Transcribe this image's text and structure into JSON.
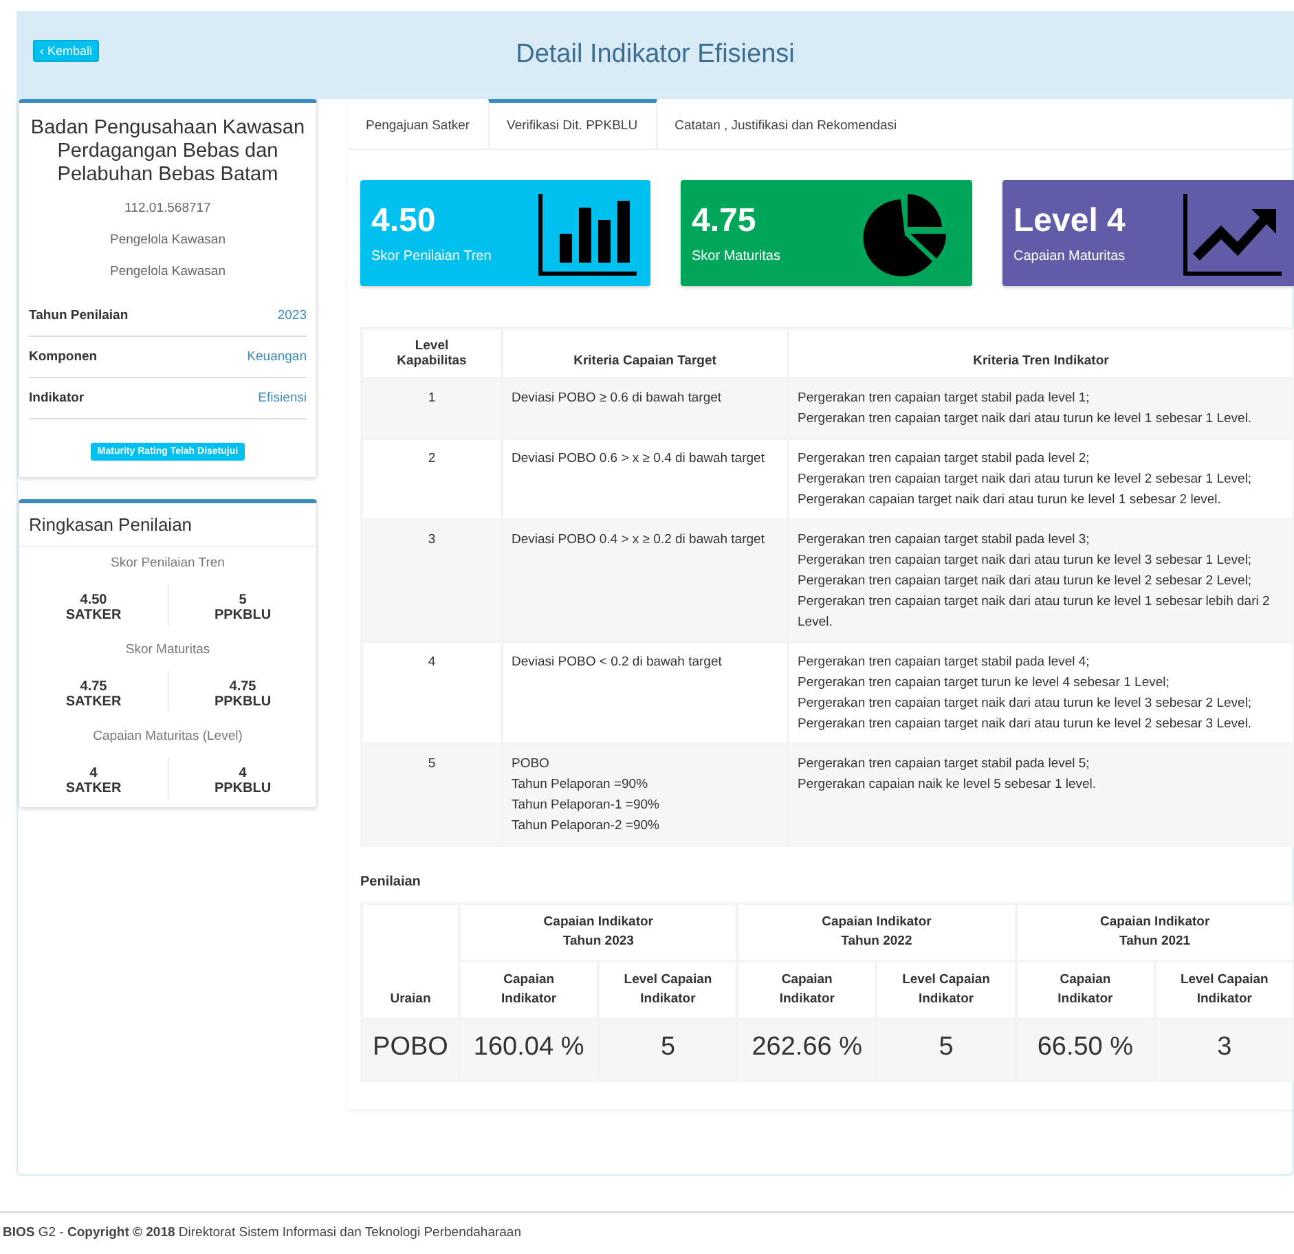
{
  "header": {
    "back_button": "‹ Kembali",
    "title": "Detail Indikator Efisiensi"
  },
  "profile": {
    "name": "Badan Pengusahaan Kawasan Perdagangan Bebas dan Pelabuhan Bebas Batam",
    "code": "112.01.568717",
    "lines": [
      "Pengelola Kawasan",
      "Pengelola Kawasan"
    ],
    "fields": [
      {
        "label": "Tahun Penilaian",
        "value": "2023"
      },
      {
        "label": "Komponen",
        "value": "Keuangan"
      },
      {
        "label": "Indikator",
        "value": "Efisiensi"
      }
    ],
    "status_badge": "Maturity Rating Telah Disetujui"
  },
  "summary": {
    "title": "Ringkasan Penilaian",
    "groups": [
      {
        "title": "Skor Penilaian Tren",
        "items": [
          {
            "value": "4.50",
            "label": "SATKER"
          },
          {
            "value": "5",
            "label": "PPKBLU"
          }
        ]
      },
      {
        "title": "Skor Maturitas",
        "items": [
          {
            "value": "4.75",
            "label": "SATKER"
          },
          {
            "value": "4.75",
            "label": "PPKBLU"
          }
        ]
      },
      {
        "title": "Capaian Maturitas (Level)",
        "items": [
          {
            "value": "4",
            "label": "SATKER"
          },
          {
            "value": "4",
            "label": "PPKBLU"
          }
        ]
      }
    ]
  },
  "tabs": [
    {
      "label": "Pengajuan Satker",
      "selected": false
    },
    {
      "label": "Verifikasi Dit. PPKBLU",
      "selected": true
    },
    {
      "label": "Catatan , Justifikasi dan Rekomendasi",
      "selected": false
    }
  ],
  "stat_cards": [
    {
      "value": "4.50",
      "label": "Skor Penilaian Tren",
      "color": "#00c0ef",
      "kind": "bars"
    },
    {
      "value": "4.75",
      "label": "Skor Maturitas",
      "color": "#00a65a",
      "kind": "pie"
    },
    {
      "value": "Level 4",
      "label": "Capaian Maturitas",
      "color": "#605ca8",
      "kind": "trend"
    }
  ],
  "criteria_table": {
    "columns": [
      [
        "Level",
        "Kapabilitas"
      ],
      [
        "Kriteria Capaian Target"
      ],
      [
        "Kriteria Tren Indikator"
      ]
    ],
    "rows": [
      {
        "level": "1",
        "target": [
          "Deviasi POBO ≥ 0.6 di bawah target"
        ],
        "trend": [
          "Pergerakan tren capaian target stabil pada level 1;",
          "Pergerakan tren capaian target naik dari atau turun ke level 1 sebesar 1 Level."
        ]
      },
      {
        "level": "2",
        "target": [
          "Deviasi POBO 0.6 > x ≥ 0.4 di bawah target"
        ],
        "trend": [
          "Pergerakan tren capaian target stabil pada level 2;",
          "Pergerakan tren capaian target naik dari atau turun ke level 2 sebesar 1 Level;",
          "Pergerakan capaian target naik dari atau turun ke level 1 sebesar 2 level."
        ]
      },
      {
        "level": "3",
        "target": [
          "Deviasi POBO 0.4 > x ≥ 0.2 di bawah target"
        ],
        "trend": [
          "Pergerakan tren capaian target stabil pada level 3;",
          "Pergerakan tren capaian target naik dari atau turun ke level 3 sebesar 1 Level;",
          "Pergerakan tren capaian target naik dari atau turun ke level 2 sebesar 2 Level;",
          "Pergerakan tren capaian target naik dari atau turun ke level 1 sebesar lebih dari 2 Level."
        ]
      },
      {
        "level": "4",
        "target": [
          "Deviasi POBO < 0.2 di bawah target"
        ],
        "trend": [
          "Pergerakan tren capaian target stabil pada level 4;",
          "Pergerakan tren capaian target turun ke level 4 sebesar 1 Level;",
          "Pergerakan tren capaian target naik dari atau turun ke level 3 sebesar 2 Level;",
          "Pergerakan tren capaian target naik dari atau turun ke level 2 sebesar 3 Level."
        ]
      },
      {
        "level": "5",
        "target": [
          "POBO",
          "Tahun Pelaporan =90%",
          "Tahun Pelaporan-1 =90%",
          "Tahun Pelaporan-2 =90%"
        ],
        "trend": [
          "Pergerakan tren capaian target stabil pada level 5;",
          "Pergerakan capaian naik ke level 5 sebesar 1 level."
        ]
      }
    ]
  },
  "assessment": {
    "title": "Penilaian",
    "row_header": "Uraian",
    "years": [
      {
        "title": [
          "Capaian Indikator",
          "Tahun 2023"
        ],
        "sub_columns": [
          [
            "Capaian",
            "Indikator"
          ],
          [
            "Level Capaian",
            "Indikator"
          ]
        ]
      },
      {
        "title": [
          "Capaian Indikator",
          "Tahun 2022"
        ],
        "sub_columns": [
          [
            "Capaian",
            "Indikator"
          ],
          [
            "Level Capaian",
            "Indikator"
          ]
        ]
      },
      {
        "title": [
          "Capaian Indikator",
          "Tahun 2021"
        ],
        "sub_columns": [
          [
            "Capaian",
            "Indikator"
          ],
          [
            "Level Capaian",
            "Indikator"
          ]
        ]
      }
    ],
    "rows": [
      {
        "name": "POBO",
        "cells": [
          "160.04 %",
          "5",
          "262.66 %",
          "5",
          "66.50 %",
          "3"
        ]
      }
    ]
  },
  "footer": "**BIOS** G2 - **Copyright © 2018** Direktorat Sistem Informasi dan Teknologi Perbendaharaan"
}
